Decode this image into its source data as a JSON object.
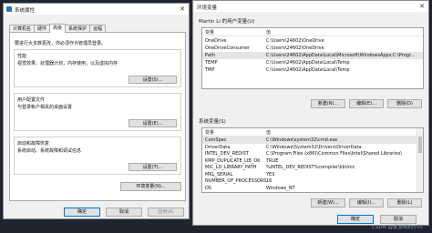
{
  "sys_props": {
    "title": "系统属性",
    "tabs": [
      "计算机名",
      "硬件",
      "高级",
      "系统保护",
      "远程"
    ],
    "admin_note": "要进行大多数更改，你必须作为管理员登录。",
    "performance": {
      "title": "性能",
      "desc": "视觉效果，处理器计划，内存使用，以及虚拟内存",
      "button": "设置(S)..."
    },
    "profiles": {
      "title": "用户配置文件",
      "desc": "与登录帐户相关的桌面设置",
      "button": "设置(E)..."
    },
    "startup": {
      "title": "启动和故障恢复",
      "desc": "系统启动、系统故障和调试信息",
      "button": "设置(T)..."
    },
    "env_button": "环境变量(N)...",
    "ok": "确定",
    "cancel": "取消",
    "apply": "应用(A)"
  },
  "env_vars": {
    "title": "环境变量",
    "user_section": "Martin Li 的用户变量(U)",
    "columns": {
      "var": "变量",
      "val": "值"
    },
    "user_vars": [
      {
        "name": "OneDrive",
        "value": "C:\\Users\\24602\\OneDrive"
      },
      {
        "name": "OneDriveConsumer",
        "value": "C:\\Users\\24602\\OneDrive"
      },
      {
        "name": "Path",
        "value": "C:\\Users\\24602\\AppData\\Local\\Microsoft\\WindowsApps;C:\\Progr..."
      },
      {
        "name": "TEMP",
        "value": "C:\\Users\\24602\\AppData\\Local\\Temp"
      },
      {
        "name": "TMP",
        "value": "C:\\Users\\24602\\AppData\\Local\\Temp"
      }
    ],
    "user_buttons": {
      "new": "新建(N)...",
      "edit": "编辑(E)...",
      "delete": "删除(D)"
    },
    "sys_section": "系统变量(S)",
    "sys_vars": [
      {
        "name": "ComSpec",
        "value": "C:\\Windows\\system32\\cmd.exe"
      },
      {
        "name": "DriverData",
        "value": "C:\\Windows\\System32\\Drivers\\DriverData"
      },
      {
        "name": "INTEL_DEV_REDIST",
        "value": "C:\\Program Files (x86)\\Common Files\\Intel\\Shared Libraries\\"
      },
      {
        "name": "KMP_DUPLICATE_LIB_OK",
        "value": "TRUE"
      },
      {
        "name": "MIC_LD_LIBRARY_PATH",
        "value": "%INTEL_DEV_REDIST%compiler\\lib\\mic"
      },
      {
        "name": "MKL_SERIAL",
        "value": "YES"
      },
      {
        "name": "NUMBER_OF_PROCESSORS",
        "value": "16"
      },
      {
        "name": "OS",
        "value": "Windows_NT"
      }
    ],
    "sys_buttons": {
      "new": "新建(W)...",
      "edit": "编辑(I)...",
      "delete": "删除(L)"
    },
    "ok": "确定",
    "cancel": "取消"
  },
  "watermark": "CSDN @爱发明的小兴"
}
